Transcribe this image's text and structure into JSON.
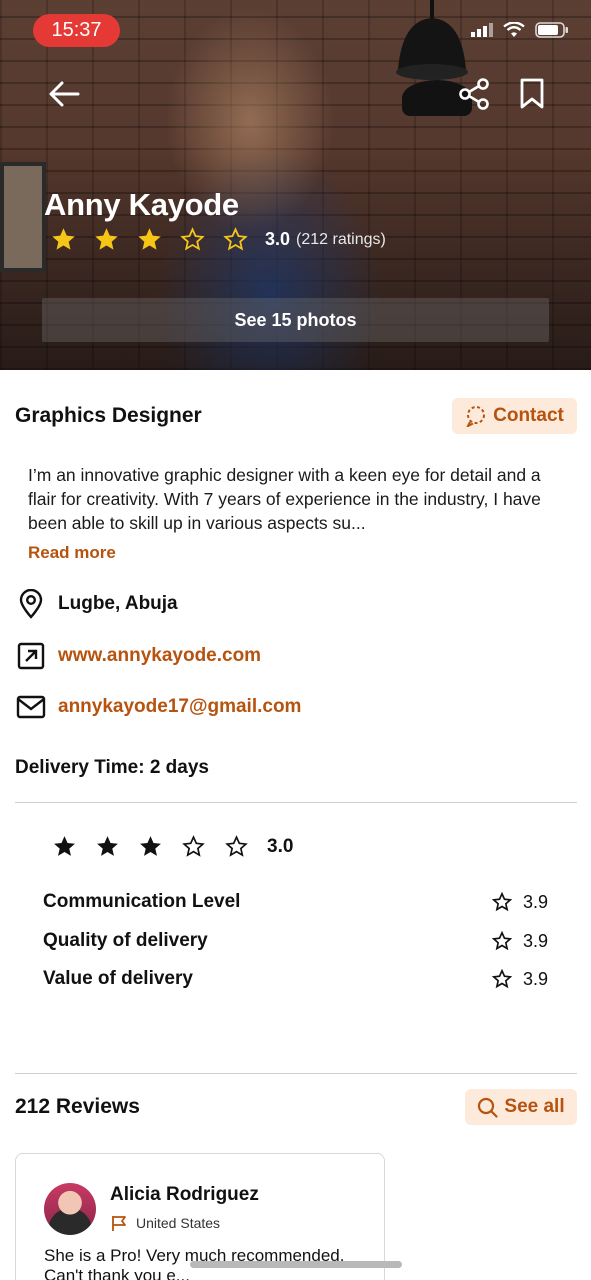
{
  "status_bar": {
    "time": "15:37"
  },
  "hero": {
    "name": "Anny Kayode",
    "rating_value": "3.0",
    "rating_count": "(212 ratings)",
    "stars": {
      "filled": 3,
      "total": 5
    },
    "photos_button": "See 15 photos"
  },
  "profile": {
    "role": "Graphics Designer",
    "contact_label": "Contact",
    "bio": "I’m an innovative graphic designer with a keen eye for detail and a flair for creativity. With 7 years of experience in the industry, I have been able to skill up in various aspects su...",
    "read_more": "Read more",
    "location": "Lugbe, Abuja",
    "website": "www.annykayode.com",
    "email": "annykayode17@gmail.com",
    "delivery": "Delivery Time: 2 days"
  },
  "ratings": {
    "overall": "3.0",
    "stars": {
      "filled": 3,
      "total": 5
    },
    "metrics": [
      {
        "label": "Communication Level",
        "value": "3.9"
      },
      {
        "label": "Quality of delivery",
        "value": "3.9"
      },
      {
        "label": "Value of delivery",
        "value": "3.9"
      }
    ]
  },
  "reviews": {
    "title": "212 Reviews",
    "see_all": "See all",
    "items": [
      {
        "name": "Alicia Rodriguez",
        "country": "United States",
        "text": "She is a Pro! Very much recommended. Can't thank you e..."
      }
    ]
  },
  "colors": {
    "accent": "#b5530f",
    "accent_bg": "#fdeadb",
    "star_gold": "#f5c518",
    "time_pill": "#e53935"
  }
}
